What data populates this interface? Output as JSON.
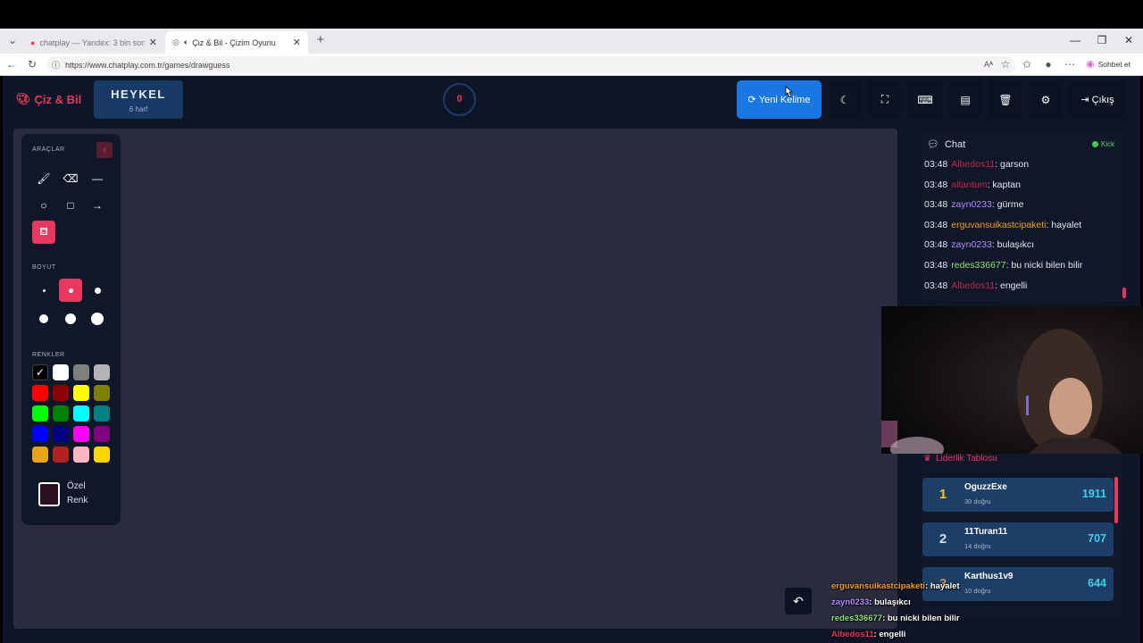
{
  "browser": {
    "tabs": [
      {
        "label": "chatplay — Yandex: 3 bin sonuç bu...",
        "active": false
      },
      {
        "label": "Çiz & Bil - Çizim Oyunu",
        "active": true
      }
    ],
    "url": "https://www.chatplay.com.tr/games/drawguess",
    "sohbet_label": "Sohbet et"
  },
  "app": {
    "logo": "Çiz & Bil",
    "word": "HEYKEL",
    "word_length": "6 harf",
    "timer": "0",
    "new_word_label": "Yeni Kelime",
    "logout_label": "Çıkış"
  },
  "tools": {
    "title": "ARAÇLAR",
    "size_label": "BOYUT",
    "colors_label": "RENKLER",
    "custom_color_label_1": "Özel",
    "custom_color_label_2": "Renk",
    "colors": [
      "#000000",
      "#ffffff",
      "#7f7f7f",
      "#b3b3b3",
      "#ff0000",
      "#8b0000",
      "#ffff00",
      "#808000",
      "#00ff00",
      "#008000",
      "#00ffff",
      "#008080",
      "#0000ff",
      "#000080",
      "#ff00ff",
      "#800080",
      "#e8a317",
      "#b22222",
      "#ffb6c1",
      "#ffd700"
    ]
  },
  "chat": {
    "title": "Chat",
    "platform": "Kick",
    "messages": [
      {
        "time": "03:48",
        "user": "Albedos11",
        "color": "#c0254a",
        "text": ": garson"
      },
      {
        "time": "03:48",
        "user": "altantum",
        "color": "#c0254a",
        "text": ": kaptan"
      },
      {
        "time": "03:48",
        "user": "zayn0233",
        "color": "#b58cff",
        "text": ": gürme"
      },
      {
        "time": "03:48",
        "user": "erguvansuikastcipaketi",
        "color": "#f0a020",
        "text": ": hayalet"
      },
      {
        "time": "03:48",
        "user": "zayn0233",
        "color": "#b58cff",
        "text": ": bulaşıkcı"
      },
      {
        "time": "03:48",
        "user": "redes336677",
        "color": "#8fe37a",
        "text": ": bu nicki bilen bilir"
      },
      {
        "time": "03:48",
        "user": "Albedos11",
        "color": "#c0254a",
        "text": ": engelli"
      }
    ]
  },
  "leaderboard": {
    "title": "Liderlik Tablosu",
    "entries": [
      {
        "rank": "1",
        "name": "OguzzExe",
        "sub": "30 doğru",
        "score": "1911"
      },
      {
        "rank": "2",
        "name": "11Turan11",
        "sub": "14 doğru",
        "score": "707"
      },
      {
        "rank": "3",
        "name": "Karthus1v9",
        "sub": "10 doğru",
        "score": "644"
      }
    ]
  },
  "overlay_chat": [
    {
      "user": "erguvansuikastcipaketi",
      "color": "#f0a020",
      "text": ": hayalet"
    },
    {
      "user": "zayn0233",
      "color": "#b58cff",
      "text": ": bulaşıkcı"
    },
    {
      "user": "redes336677",
      "color": "#8fe37a",
      "text": ": bu nicki bilen bilir"
    },
    {
      "user": "Albedos11",
      "color": "#e8385e",
      "text": ": engelli"
    }
  ]
}
